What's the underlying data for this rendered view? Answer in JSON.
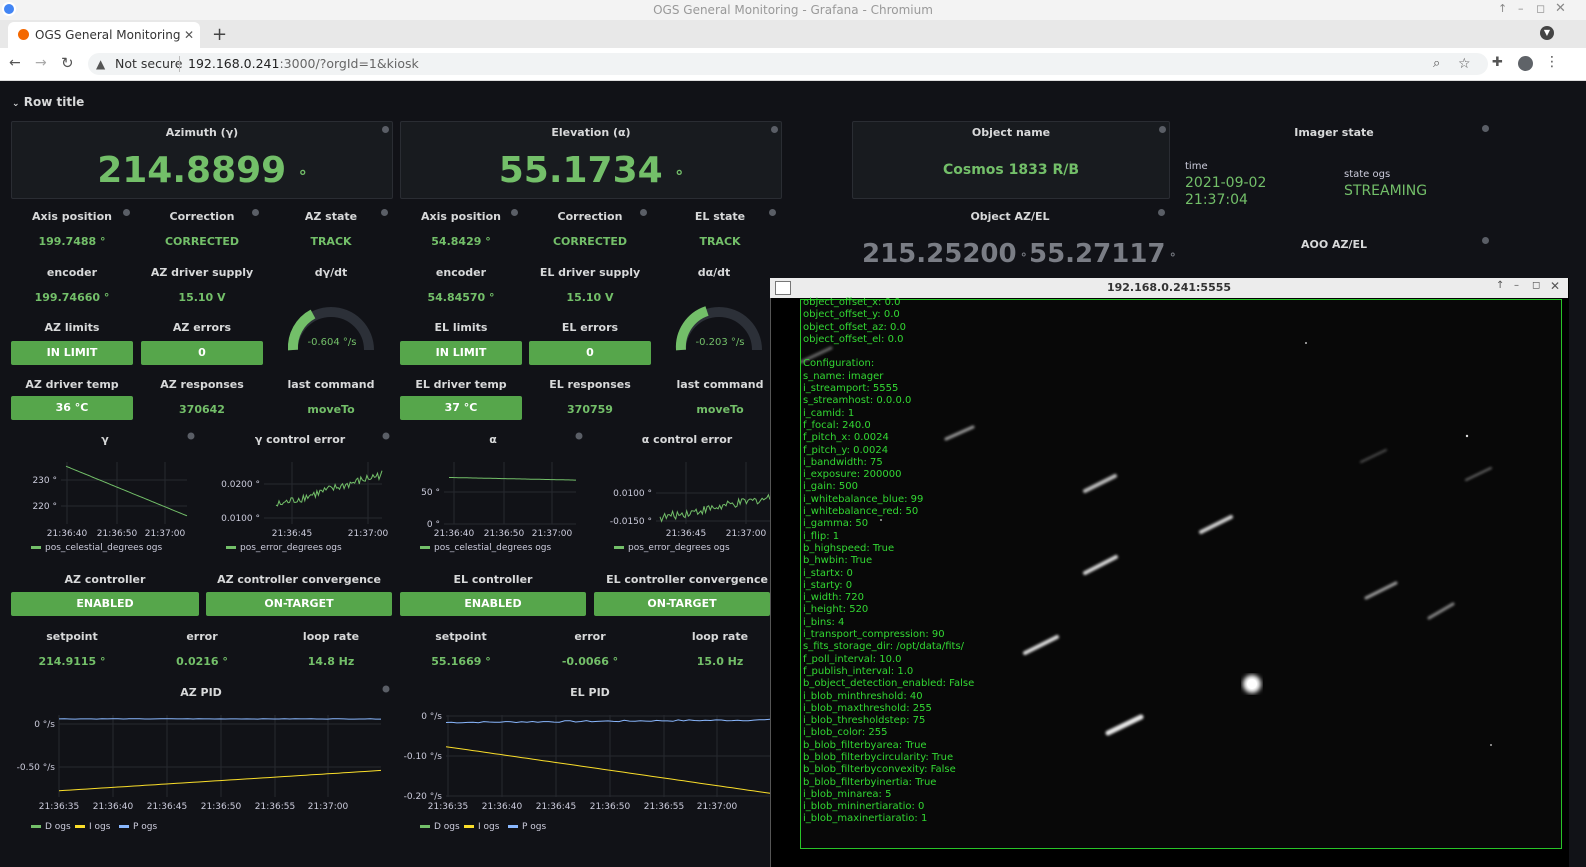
{
  "window": {
    "title": "OGS General Monitoring - Grafana - Chromium"
  },
  "tabs": [
    {
      "label": "OGS General Monitoring - Graf"
    }
  ],
  "address": {
    "security": "Not secure",
    "host": "192.168.0.241",
    "path": ":3000/?orgId=1&kiosk"
  },
  "dashboard": {
    "row_title": "Row title",
    "az": {
      "title": "Azimuth (γ)",
      "value": "214.8899",
      "unit": "°",
      "axis_position_label": "Axis position",
      "axis_position": "199.7488 °",
      "correction_label": "Correction",
      "correction": "CORRECTED",
      "state_label": "AZ state",
      "state": "TRACK",
      "encoder_label": "encoder",
      "encoder": "199.74660 °",
      "driver_supply_label": "AZ driver supply",
      "driver_supply": "15.10 V",
      "rate_label": "dγ/dt",
      "rate": "-0.604 °/s",
      "limits_label": "AZ limits",
      "limits": "IN LIMIT",
      "errors_label": "AZ errors",
      "errors": "0",
      "driver_temp_label": "AZ driver temp",
      "driver_temp": "36 °C",
      "responses_label": "AZ responses",
      "responses": "370642",
      "last_command_label": "last command",
      "last_command": "moveTo",
      "controller_label": "AZ controller",
      "controller": "ENABLED",
      "convergence_label": "AZ controller convergence",
      "convergence": "ON-TARGET",
      "setpoint_label": "setpoint",
      "setpoint": "214.9115 °",
      "error_label": "error",
      "error": "0.0216 °",
      "loop_rate_label": "loop rate",
      "loop_rate": "14.8 Hz",
      "pid_title": "AZ PID"
    },
    "el": {
      "title": "Elevation (α)",
      "value": "55.1734",
      "unit": "°",
      "axis_position_label": "Axis position",
      "axis_position": "54.8429 °",
      "correction_label": "Correction",
      "correction": "CORRECTED",
      "state_label": "EL state",
      "state": "TRACK",
      "encoder_label": "encoder",
      "encoder": "54.84570 °",
      "driver_supply_label": "EL driver supply",
      "driver_supply": "15.10 V",
      "rate_label": "dα/dt",
      "rate": "-0.203 °/s",
      "limits_label": "EL limits",
      "limits": "IN LIMIT",
      "errors_label": "EL errors",
      "errors": "0",
      "driver_temp_label": "EL driver temp",
      "driver_temp": "37 °C",
      "responses_label": "EL responses",
      "responses": "370759",
      "last_command_label": "last command",
      "last_command": "moveTo",
      "controller_label": "EL controller",
      "controller": "ENABLED",
      "convergence_label": "EL controller convergence",
      "convergence": "ON-TARGET",
      "setpoint_label": "setpoint",
      "setpoint": "55.1669 °",
      "error_label": "error",
      "error": "-0.0066 °",
      "loop_rate_label": "loop rate",
      "loop_rate": "15.0 Hz",
      "pid_title": "EL PID"
    },
    "object": {
      "name_label": "Object name",
      "name": "Cosmos 1833 R/B",
      "azel_label": "Object AZ/EL",
      "az": "215.25200",
      "el": "55.27117",
      "unit": "°"
    },
    "imager": {
      "title": "Imager state",
      "time_label": "time",
      "date": "2021-09-02",
      "time": "21:37:04",
      "state_label": "state ogs",
      "state": "STREAMING"
    },
    "aoo_label": "AOO AZ/EL"
  },
  "chart_data": [
    {
      "type": "line",
      "title": "γ",
      "yticks": [
        "230 °",
        "220 °"
      ],
      "xticks": [
        "21:36:40",
        "21:36:50",
        "21:37:00"
      ],
      "series": [
        {
          "name": "pos_celestial_degrees ogs",
          "x": [
            "21:36:38",
            "21:37:04"
          ],
          "y": [
            232.5,
            214.9
          ]
        }
      ],
      "ylim": [
        212,
        234
      ],
      "color": "#73bf69"
    },
    {
      "type": "line",
      "title": "γ control error",
      "yticks": [
        "0.0200 °",
        "0.0100 °"
      ],
      "xticks": [
        "21:36:45",
        "21:37:00"
      ],
      "series": [
        {
          "name": "pos_error_degrees ogs",
          "x": [
            "21:36:40",
            "21:37:04"
          ],
          "y": [
            0.012,
            0.022
          ]
        }
      ],
      "ylim": [
        0.006,
        0.026
      ],
      "color": "#73bf69"
    },
    {
      "type": "line",
      "title": "α",
      "yticks": [
        "50 °",
        "0 °"
      ],
      "xticks": [
        "21:36:40",
        "21:36:50",
        "21:37:00"
      ],
      "series": [
        {
          "name": "pos_celestial_degrees ogs",
          "x": [
            "21:36:38",
            "21:37:04"
          ],
          "y": [
            58.8,
            55.2
          ]
        }
      ],
      "ylim": [
        -5,
        80
      ],
      "color": "#73bf69"
    },
    {
      "type": "line",
      "title": "α control error",
      "yticks": [
        "0.0100 °",
        "-0.0150 °"
      ],
      "xticks": [
        "21:36:45",
        "21:37:00"
      ],
      "series": [
        {
          "name": "pos_error_degrees ogs",
          "x": [
            "21:36:41",
            "21:37:04"
          ],
          "y": [
            -0.018,
            -0.005
          ]
        }
      ],
      "ylim": [
        -0.022,
        0.018
      ],
      "color": "#73bf69"
    },
    {
      "type": "line",
      "title": "AZ PID",
      "yticks": [
        "0 °/s",
        "-0.50 °/s"
      ],
      "xticks": [
        "21:36:35",
        "21:36:40",
        "21:36:45",
        "21:36:50",
        "21:36:55",
        "21:37:00"
      ],
      "series": [
        {
          "name": "D ogs",
          "color": "#73bf69"
        },
        {
          "name": "I ogs",
          "values": [
            -0.92,
            -0.66
          ],
          "color": "#fade2a"
        },
        {
          "name": "P ogs",
          "values": [
            0.0,
            0.0
          ],
          "color": "#8ab8ff"
        }
      ],
      "ylim": [
        -1.0,
        0.05
      ]
    },
    {
      "type": "line",
      "title": "EL PID",
      "yticks": [
        "0 °/s",
        "-0.10 °/s",
        "-0.20 °/s"
      ],
      "xticks": [
        "21:36:35",
        "21:36:40",
        "21:36:45",
        "21:36:50",
        "21:36:55",
        "21:37:00"
      ],
      "series": [
        {
          "name": "D ogs",
          "color": "#73bf69"
        },
        {
          "name": "I ogs",
          "values": [
            -0.075,
            -0.2
          ],
          "color": "#fade2a"
        },
        {
          "name": "P ogs",
          "values": [
            -0.01,
            -0.003
          ],
          "color": "#8ab8ff"
        }
      ],
      "ylim": [
        -0.21,
        0.01
      ]
    }
  ],
  "imager_window": {
    "title": "192.168.0.241:5555",
    "config_lines": [
      "object_offset_x: 0.0",
      "object_offset_y: 0.0",
      "object_offset_az: 0.0",
      "object_offset_el: 0.0",
      "",
      "Configuration:",
      "s_name: imager",
      "i_streamport: 5555",
      "s_streamhost: 0.0.0.0",
      "i_camid: 1",
      "f_focal: 240.0",
      "f_pitch_x: 0.0024",
      "f_pitch_y: 0.0024",
      "i_bandwidth: 75",
      "i_exposure: 200000",
      "i_gain: 500",
      "i_whitebalance_blue: 99",
      "i_whitebalance_red: 50",
      "i_gamma: 50",
      "i_flip: 1",
      "b_highspeed: True",
      "b_hwbin: True",
      "i_startx: 0",
      "i_starty: 0",
      "i_width: 720",
      "i_height: 520",
      "i_bins: 4",
      "i_transport_compression: 90",
      "s_fits_storage_dir: /opt/data/fits/",
      "f_poll_interval: 10.0",
      "f_publish_interval: 1.0",
      "b_object_detection_enabled: False",
      "i_blob_minthreshold: 40",
      "i_blob_maxthreshold: 255",
      "i_blob_thresholdstep: 75",
      "i_blob_color: 255",
      "b_blob_filterbyarea: True",
      "b_blob_filterbycircularity: True",
      "b_blob_filterbyconvexity: False",
      "b_blob_filterbyinertia: True",
      "i_blob_minarea: 5",
      "i_blob_mininertiaratio: 0",
      "i_blob_maxinertiaratio: 1"
    ]
  }
}
